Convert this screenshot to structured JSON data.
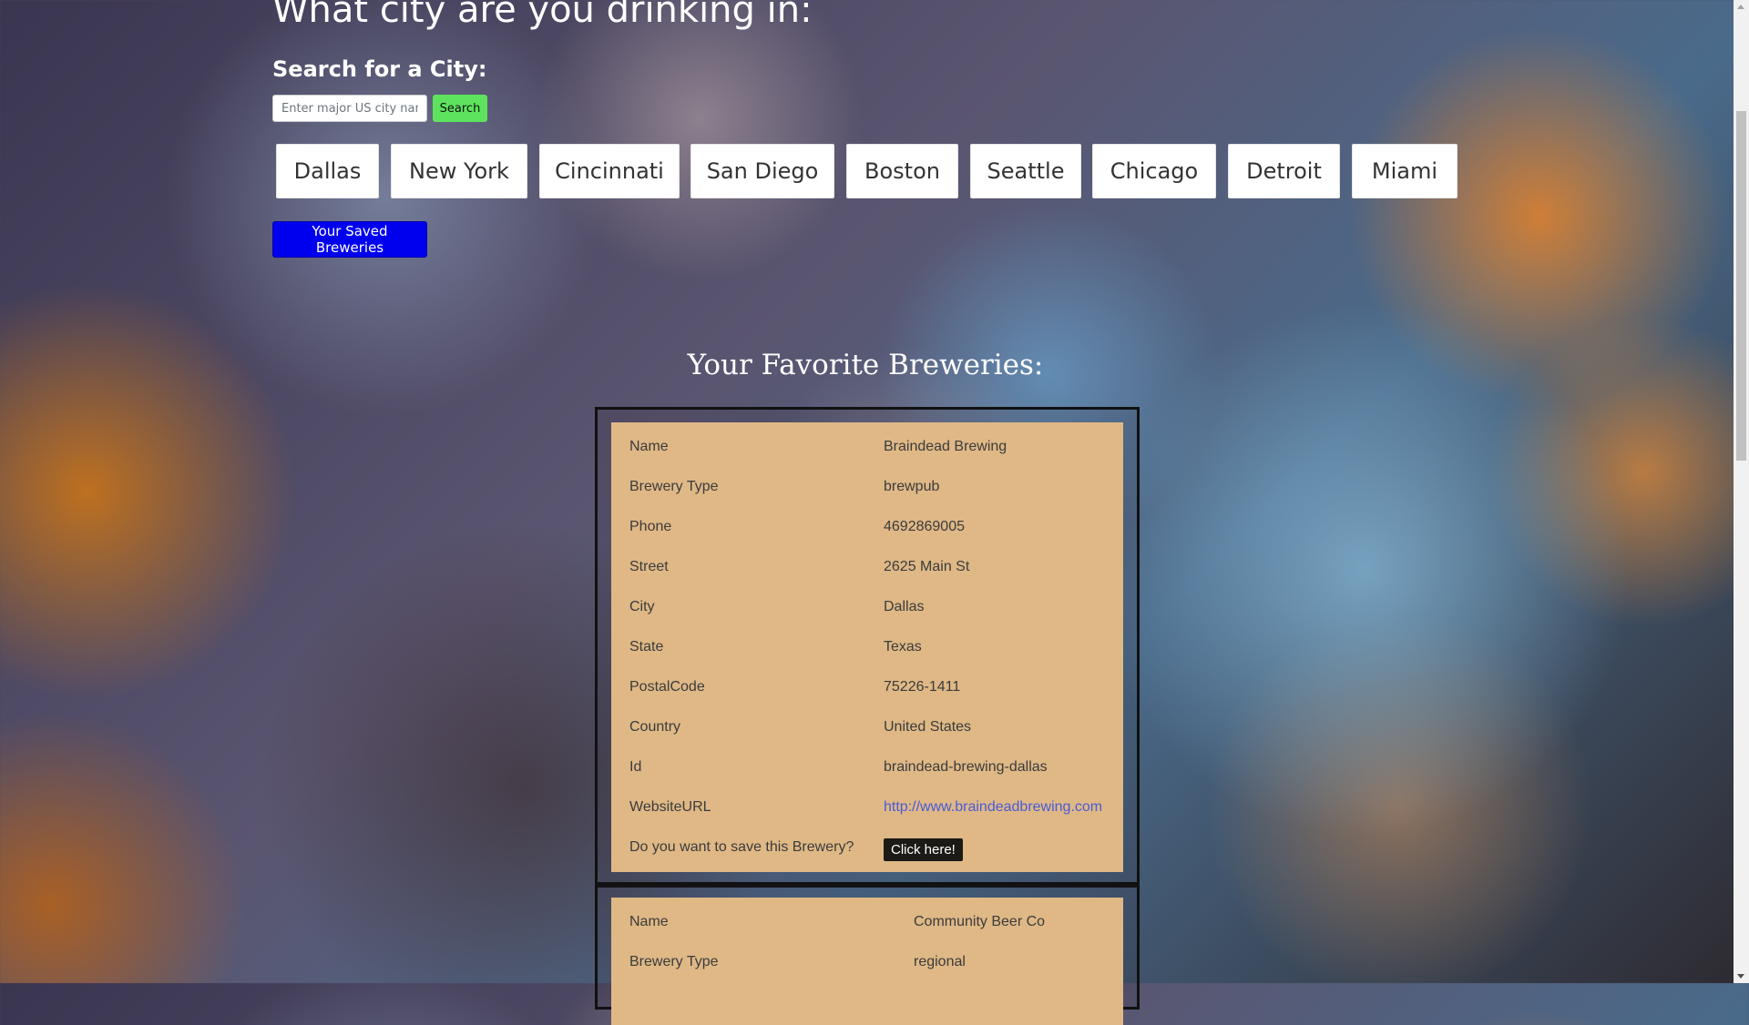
{
  "header": {
    "title": "What city are you drinking in:",
    "search_label": "Search for a City:",
    "search_placeholder": "Enter major US city name",
    "search_button": "Search"
  },
  "cities": [
    "Dallas",
    "New York",
    "Cincinnati",
    "San Diego",
    "Boston",
    "Seattle",
    "Chicago",
    "Detroit",
    "Miami"
  ],
  "saved_button": "Your Saved Breweries",
  "favorites": {
    "heading": "Your Favorite Breweries:",
    "save_prompt": "Do you want to save this Brewery?",
    "save_button": "Click here!",
    "labels": {
      "name": "Name",
      "type": "Brewery Type",
      "phone": "Phone",
      "street": "Street",
      "city": "City",
      "state": "State",
      "postal": "PostalCode",
      "country": "Country",
      "id": "Id",
      "website": "WebsiteURL"
    },
    "breweries": [
      {
        "name": "Braindead Brewing",
        "type": "brewpub",
        "phone": "4692869005",
        "street": "2625 Main St",
        "city": "Dallas",
        "state": "Texas",
        "postal": "75226-1411",
        "country": "United States",
        "id": "braindead-brewing-dallas",
        "website": "http://www.braindeadbrewing.com"
      },
      {
        "name": "Community Beer Co",
        "type": "regional"
      }
    ]
  },
  "colors": {
    "search_button": "#5ee35e",
    "saved_button": "#0000ee",
    "card_background": "#dfb886",
    "link": "#4a5bd6"
  }
}
